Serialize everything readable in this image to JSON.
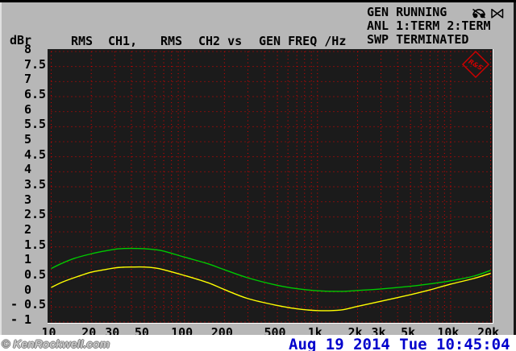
{
  "status": {
    "gen": "GEN RUNNING",
    "anl": "ANL 1:TERM 2:TERM",
    "swp": "SWP TERMINATED"
  },
  "footer": {
    "watermark": "© KenRockwell.com",
    "datetime": "Aug 19 2014 Tue 10:45:04",
    "datetime_color": "#0000cc"
  },
  "chart_data": {
    "type": "line",
    "title_parts": [
      "RMS",
      "CH1,",
      "RMS",
      "CH2 vs",
      "GEN FREQ /Hz"
    ],
    "ylabel": "dBr",
    "xscale": "log",
    "xlim": [
      10,
      20000
    ],
    "ylim": [
      -1,
      8
    ],
    "ytick_step": 0.5,
    "yticks": [
      8,
      7.5,
      7,
      6.5,
      6,
      5.5,
      5,
      4.5,
      4,
      3.5,
      3,
      2.5,
      2,
      1.5,
      1,
      0.5,
      0,
      -0.5,
      -1
    ],
    "xticks": [
      {
        "value": 10,
        "label": "10"
      },
      {
        "value": 20,
        "label": "20"
      },
      {
        "value": 30,
        "label": "30"
      },
      {
        "value": 50,
        "label": "50"
      },
      {
        "value": 100,
        "label": "100"
      },
      {
        "value": 200,
        "label": "200"
      },
      {
        "value": 500,
        "label": "500"
      },
      {
        "value": 1000,
        "label": "1k"
      },
      {
        "value": 2000,
        "label": "2k"
      },
      {
        "value": 3000,
        "label": "3k"
      },
      {
        "value": 5000,
        "label": "5k"
      },
      {
        "value": 10000,
        "label": "10k"
      },
      {
        "value": 20000,
        "label": "20k"
      }
    ],
    "grid_x": [
      10,
      20,
      30,
      40,
      50,
      60,
      70,
      80,
      90,
      100,
      200,
      300,
      400,
      500,
      600,
      700,
      800,
      900,
      1000,
      2000,
      3000,
      4000,
      5000,
      6000,
      7000,
      8000,
      9000,
      10000,
      20000
    ],
    "grid_style": "dotted",
    "grid_color": "#e10000",
    "plot_bg": "#1b1b1b",
    "logo_text": "R&S",
    "logo_color": "#cc0000",
    "series": [
      {
        "name": "RMS CH1",
        "color": "#00c800",
        "points": [
          [
            10,
            0.78
          ],
          [
            12,
            0.95
          ],
          [
            15,
            1.12
          ],
          [
            20,
            1.27
          ],
          [
            25,
            1.36
          ],
          [
            30,
            1.42
          ],
          [
            35,
            1.445
          ],
          [
            40,
            1.45
          ],
          [
            50,
            1.44
          ],
          [
            60,
            1.41
          ],
          [
            70,
            1.36
          ],
          [
            100,
            1.16
          ],
          [
            150,
            0.94
          ],
          [
            200,
            0.74
          ],
          [
            300,
            0.47
          ],
          [
            500,
            0.22
          ],
          [
            700,
            0.11
          ],
          [
            1000,
            0.04
          ],
          [
            1500,
            0.02
          ],
          [
            2000,
            0.05
          ],
          [
            3000,
            0.1
          ],
          [
            5000,
            0.19
          ],
          [
            7000,
            0.27
          ],
          [
            10000,
            0.37
          ],
          [
            15000,
            0.53
          ],
          [
            20000,
            0.72
          ]
        ]
      },
      {
        "name": "RMS CH2",
        "color": "#ffff00",
        "points": [
          [
            10,
            0.15
          ],
          [
            12,
            0.32
          ],
          [
            15,
            0.48
          ],
          [
            20,
            0.66
          ],
          [
            25,
            0.74
          ],
          [
            30,
            0.8
          ],
          [
            35,
            0.825
          ],
          [
            40,
            0.83
          ],
          [
            50,
            0.83
          ],
          [
            60,
            0.8
          ],
          [
            70,
            0.74
          ],
          [
            100,
            0.55
          ],
          [
            150,
            0.31
          ],
          [
            200,
            0.08
          ],
          [
            300,
            -0.22
          ],
          [
            500,
            -0.45
          ],
          [
            700,
            -0.56
          ],
          [
            1000,
            -0.62
          ],
          [
            1500,
            -0.6
          ],
          [
            2000,
            -0.48
          ],
          [
            3000,
            -0.31
          ],
          [
            5000,
            -0.09
          ],
          [
            7000,
            0.07
          ],
          [
            10000,
            0.26
          ],
          [
            15000,
            0.45
          ],
          [
            20000,
            0.62
          ]
        ]
      }
    ]
  }
}
